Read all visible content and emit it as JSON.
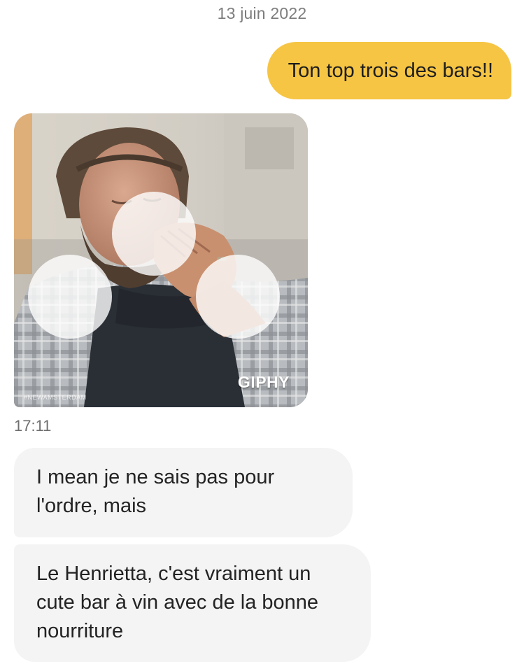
{
  "conversation": {
    "date_header": "13 juin 2022",
    "messages": [
      {
        "direction": "sent",
        "text": "Ton top trois des bars!!"
      },
      {
        "direction": "received",
        "type": "gif",
        "label": "GIPHY",
        "watermark": "#NEWAMSTERDAM"
      },
      {
        "direction": "received",
        "text": "I mean je ne sais pas pour l'ordre, mais"
      },
      {
        "direction": "received",
        "text": "Le Henrietta, c'est vraiment un cute bar à vin avec de la bonne nourriture"
      }
    ],
    "received_timestamp": "17:11"
  },
  "colors": {
    "sent_bubble": "#f6c544",
    "received_bubble": "#f4f4f4",
    "meta_text": "#7d7d7d"
  }
}
